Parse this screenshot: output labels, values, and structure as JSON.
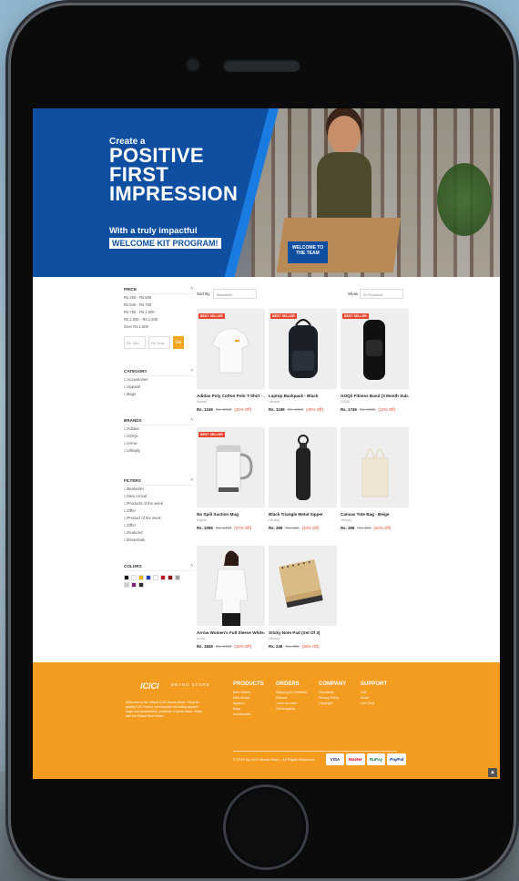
{
  "hero": {
    "line1": "Create a",
    "line2": "POSITIVE",
    "line3": "FIRST",
    "line4": "IMPRESSION",
    "sub": "With a truly impactful",
    "tag": "WELCOME KIT PROGRAM!",
    "box_label": "WELCOME TO THE TEAM"
  },
  "filters": {
    "price": {
      "title": "PRICE",
      "options": [
        "Rs.250 - Rs.500",
        "Rs.500 - Rs.750",
        "Rs.750 - Rs.1,000",
        "Rs.1,000 - Rs.1,500",
        "Over Rs.1,500"
      ],
      "min_placeholder": "Rs. Min",
      "max_placeholder": "Rs. Max",
      "go": "Go"
    },
    "category": {
      "title": "CATEGORY",
      "options": [
        "Accessories",
        "Apparel",
        "Bags"
      ]
    },
    "brands": {
      "title": "BRANDS",
      "options": [
        "Adidas",
        "GOQii",
        "Arrow",
        "Ultraply"
      ]
    },
    "features": {
      "title": "FILTERS",
      "options": [
        "Bestseller",
        "New Arrival",
        "Products of the week",
        "Offer",
        "Product of the week",
        "Offer",
        "Featured",
        "Essentials"
      ]
    },
    "colors": {
      "title": "COLORS",
      "swatches": [
        "#111111",
        "#ffffff",
        "#f2b705",
        "#1a3fb8",
        "#ffffff",
        "#c1121f",
        "#8b0000",
        "#9e9e9e",
        "#cccccc",
        "#7a1f7a",
        "#2b2b2b"
      ]
    }
  },
  "toolbar": {
    "sort_label": "Sort By",
    "sort_value": "Bestseller",
    "show_label": "Show",
    "show_value": "20 Products"
  },
  "products": [
    {
      "name": "Adidas Poly Cotton Polo T-Shirt - ...",
      "brand": "Adidas",
      "price": "Rs. 1249",
      "mrp": "Rs. 1999",
      "off": "(31% Off)",
      "badge": "BEST SELLER",
      "kind": "polo"
    },
    {
      "name": "Laptop Backpack - Black",
      "brand": "Ultraply",
      "price": "Rs. 1199",
      "mrp": "Rs. 1999",
      "off": "(40% Off)",
      "badge": "BEST SELLER",
      "kind": "backpack"
    },
    {
      "name": "GOQii Fitness Band (3 Month Sub...",
      "brand": "GOQii",
      "price": "Rs. 1749",
      "mrp": "Rs. 1999",
      "off": "(13% Off)",
      "badge": "BEST SELLER",
      "kind": "band"
    },
    {
      "name": "No Spill Suction Mug",
      "brand": "Mighty",
      "price": "Rs. 1099",
      "mrp": "Rs. 1499",
      "off": "(27% Off)",
      "badge": "BEST SELLER",
      "kind": "mug"
    },
    {
      "name": "Black Triangle Metal Sipper",
      "brand": "Ultraply",
      "price": "Rs. 399",
      "mrp": "Rs. 699",
      "off": "(43% Off)",
      "badge": "",
      "kind": "sipper"
    },
    {
      "name": "Canvas Tote Bag - Beige",
      "brand": "Ultraply",
      "price": "Rs. 399",
      "mrp": "Rs. 499",
      "off": "(20% Off)",
      "badge": "",
      "kind": "tote"
    },
    {
      "name": "Arrow Women's Full Sleeve White...",
      "brand": "Arrow",
      "price": "Rs. 1849",
      "mrp": "Rs. 2199",
      "off": "(16% Off)",
      "badge": "",
      "kind": "shirt"
    },
    {
      "name": "Sticky Note Pad (Set Of 3)",
      "brand": "Ultraply",
      "price": "Rs. 249",
      "mrp": "Rs. 399",
      "off": "(38% Off)",
      "badge": "",
      "kind": "notepad"
    }
  ],
  "footer": {
    "logo": "ICICI",
    "logo_store": "BRAND STORE",
    "desc": "Welcome to the official ICICI Brand Store. Shop for quality ICICI brand merchandise including apparel, bags and accessories, products of great value. Made with the Brand Store team.",
    "columns": [
      {
        "title": "PRODUCTS",
        "items": [
          "Best Sellers",
          "New Arrival",
          "Apparel",
          "Bags",
          "Accessories"
        ]
      },
      {
        "title": "ORDERS",
        "items": [
          "Shipping & Deliveries",
          "Returns",
          "Track an order",
          "Gift shopping"
        ]
      },
      {
        "title": "COMPANY",
        "items": [
          "Disclaimer",
          "Privacy Policy",
          "Copyright"
        ]
      },
      {
        "title": "SUPPORT",
        "items": [
          "Call",
          "Email",
          "Live Chat"
        ]
      }
    ],
    "copyright": "© 2022 by ICICI Brand Store - All Rights Reserved",
    "payments": [
      "VISA",
      "Master",
      "RuPay",
      "PayPal"
    ],
    "payment_colors": [
      "#ffffff",
      "#ffffff",
      "#ffffff",
      "#ffffff"
    ],
    "to_top": "▲"
  }
}
